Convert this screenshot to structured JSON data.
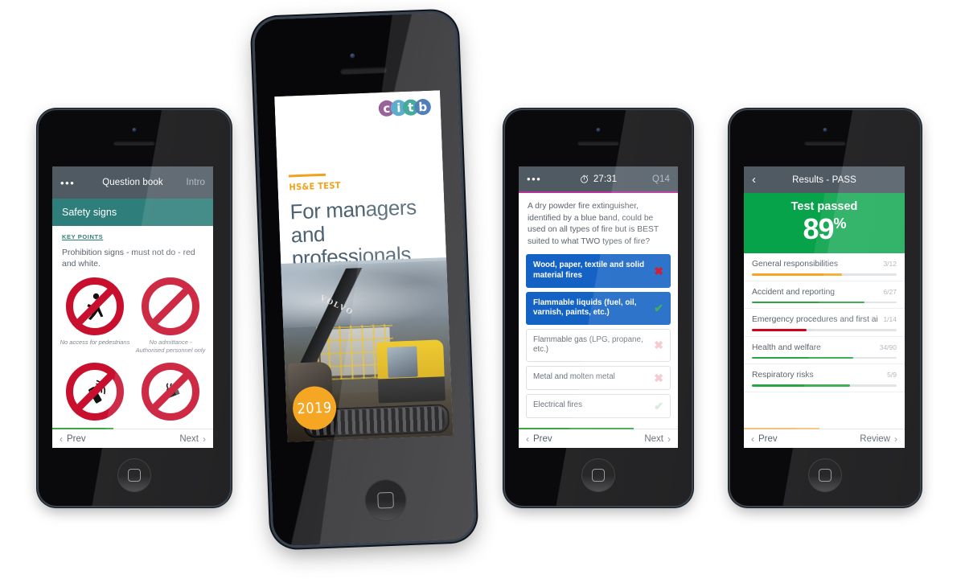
{
  "phone1": {
    "appbar": {
      "menu_icon": "overflow-menu-icon",
      "title": "Question book",
      "right_label": "Intro"
    },
    "section_title": "Safety signs",
    "key_points_label": "KEY POINTS",
    "body_text": "Prohibition signs - must not do - red and white.",
    "signs": [
      {
        "icon": "no-pedestrians-sign",
        "caption": "No access for pedestrians"
      },
      {
        "icon": "no-entry-sign",
        "caption": "No admittance - Authorised personnel only"
      },
      {
        "icon": "no-mobile-phones-sign",
        "caption": ""
      },
      {
        "icon": "no-smoking-sign",
        "caption": ""
      }
    ],
    "nav": {
      "prev": "Prev",
      "next": "Next"
    }
  },
  "phone2": {
    "logo_letters": [
      "c",
      "i",
      "t",
      "b"
    ],
    "eyebrow": "HS&E TEST",
    "title": "For managers and professionals",
    "year_badge": "2019",
    "photo_brand": "VOLVO"
  },
  "phone3": {
    "appbar": {
      "menu_icon": "overflow-menu-icon",
      "timer_icon": "stopwatch-icon",
      "timer": "27:31",
      "question_no": "Q14"
    },
    "question": "A dry powder fire extinguisher, identified by a blue band, could be used on all types of fire but is BEST suited to what TWO types of fire?",
    "answers": [
      {
        "text": "Wood, paper, textile and solid material fires",
        "selected": true,
        "mark": "cross-icon",
        "mark_style": "wrong"
      },
      {
        "text": "Flammable liquids (fuel, oil, varnish, paints, etc.)",
        "selected": true,
        "mark": "check-icon",
        "mark_style": "right"
      },
      {
        "text": "Flammable gas (LPG, propane, etc.)",
        "selected": false,
        "mark": "cross-icon",
        "mark_style": "faint-wrong"
      },
      {
        "text": "Metal and molten metal",
        "selected": false,
        "mark": "cross-icon",
        "mark_style": "faint-wrong"
      },
      {
        "text": "Electrical fires",
        "selected": false,
        "mark": "check-icon",
        "mark_style": "faint-right"
      }
    ],
    "nav": {
      "prev": "Prev",
      "next": "Next"
    }
  },
  "phone4": {
    "appbar": {
      "back_icon": "chevron-left-icon",
      "title": "Results - PASS"
    },
    "result": {
      "label": "Test passed",
      "percent": "89",
      "percent_symbol": "%"
    },
    "categories": [
      {
        "name": "General responsibilities",
        "score": "3/12",
        "fill": 62,
        "color": "#f5a623"
      },
      {
        "name": "Accident and reporting",
        "score": "6/27",
        "fill": 78,
        "color": "#2aa544"
      },
      {
        "name": "Emergency procedures and first aid",
        "score": "1/14",
        "fill": 38,
        "color": "#d0021b"
      },
      {
        "name": "Health and welfare",
        "score": "34/90",
        "fill": 70,
        "color": "#2aa544"
      },
      {
        "name": "Respiratory risks",
        "score": "5/9",
        "fill": 68,
        "color": "#2aa544"
      }
    ],
    "nav": {
      "prev": "Prev",
      "next": "Review"
    }
  },
  "colors": {
    "appbar": "#4f5a63",
    "teal": "#2e7f7b",
    "selected_blue": "#1463c4",
    "pass_green": "#07a34a",
    "accent_magenta": "#b5309a",
    "brand_orange": "#f5a623"
  }
}
